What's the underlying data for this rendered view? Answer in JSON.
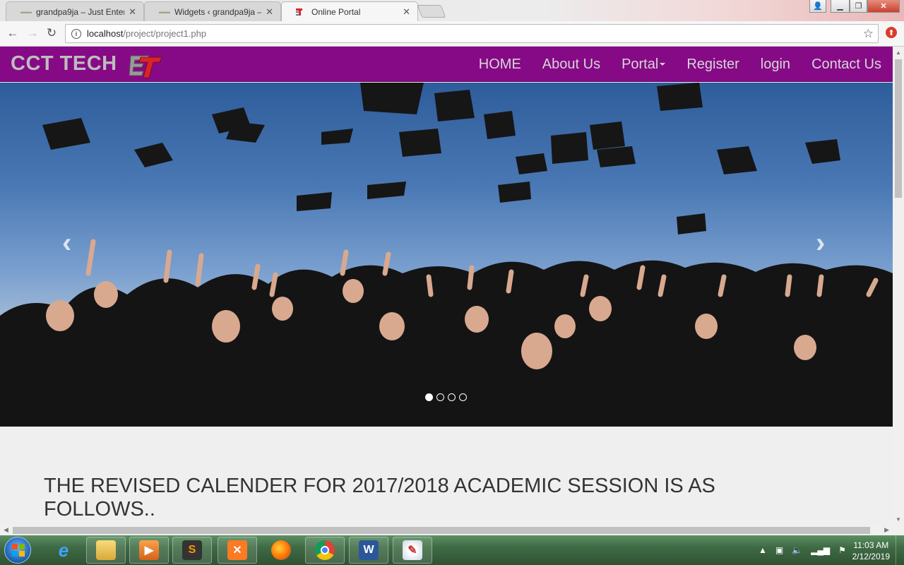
{
  "browser": {
    "tabs": [
      {
        "title": "grandpa9ja – Just Enterta",
        "favicon": "site-favicon"
      },
      {
        "title": "Widgets ‹ grandpa9ja —",
        "favicon": "site-favicon"
      },
      {
        "title": "Online Portal",
        "favicon": "cct-favicon"
      }
    ],
    "url_host": "localhost",
    "url_path": "/project/project1.php"
  },
  "site": {
    "brand": "CCT TECH",
    "nav": [
      "HOME",
      "About Us",
      "Portal",
      "Register",
      "login",
      "Contact Us"
    ],
    "carousel": {
      "slide_count": 4,
      "active_slide": 1,
      "prev": "‹",
      "next": "›"
    },
    "headline": "THE REVISED CALENDER FOR 2017/2018 ACADEMIC SESSION IS AS FOLLOWS..",
    "colors": {
      "navbar": "#860a86",
      "brand_text": "#bdbdbd",
      "logo_red": "#d9242a"
    }
  },
  "taskbar": {
    "apps": [
      "internet-explorer-icon",
      "file-explorer-icon",
      "media-player-icon",
      "sublime-text-icon",
      "xampp-icon",
      "firefox-icon",
      "chrome-icon",
      "word-icon",
      "paint-icon"
    ],
    "time": "11:03 AM",
    "date": "2/12/2019"
  }
}
